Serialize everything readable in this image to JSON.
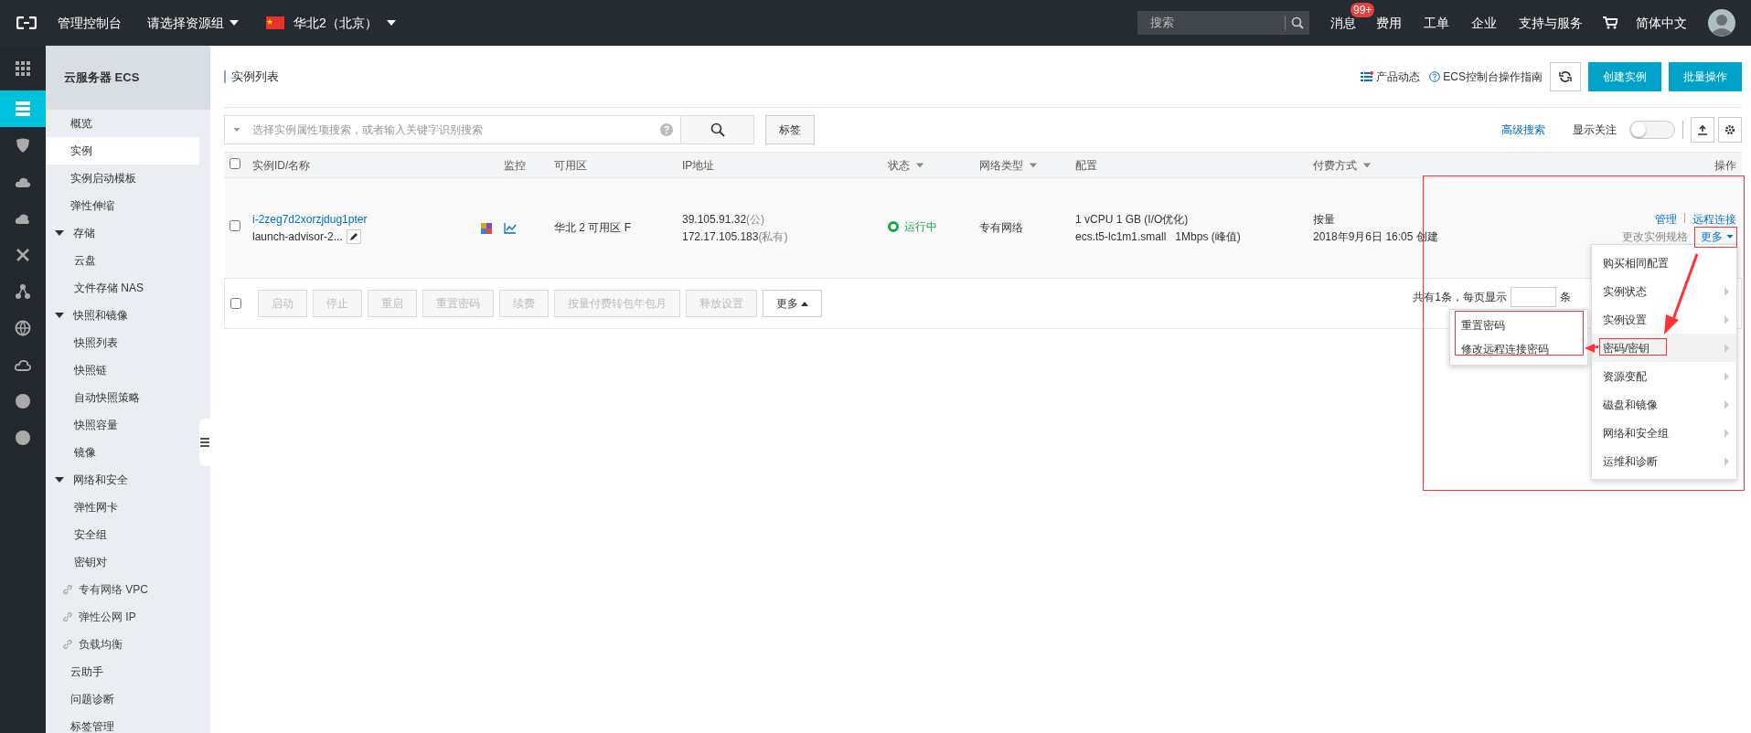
{
  "topbar": {
    "console": "管理控制台",
    "resource_group": "请选择资源组",
    "region": "华北2（北京）",
    "search": {
      "placeholder": "搜索"
    },
    "message": "消息",
    "message_badge": "99+",
    "links": [
      "费用",
      "工单",
      "企业",
      "支持与服务"
    ],
    "language": "简体中文"
  },
  "rail": [
    {
      "selected": false
    },
    {
      "selected": true
    },
    {
      "selected": false
    },
    {
      "selected": false
    },
    {
      "selected": false
    },
    {
      "selected": false
    },
    {
      "selected": false
    },
    {
      "selected": false
    },
    {
      "selected": false
    },
    {
      "selected": false
    },
    {
      "selected": false
    }
  ],
  "sidebar": {
    "title": "云服务器 ECS",
    "items": [
      {
        "kind": "item",
        "label": "概览",
        "selected": false
      },
      {
        "kind": "item",
        "label": "实例",
        "selected": true
      },
      {
        "kind": "item",
        "label": "实例启动模板",
        "selected": false
      },
      {
        "kind": "item",
        "label": "弹性伸缩",
        "selected": false
      },
      {
        "kind": "group",
        "label": "存储",
        "expanded": true,
        "children": [
          {
            "kind": "item",
            "label": "云盘",
            "selected": false
          },
          {
            "kind": "item",
            "label": "文件存储 NAS",
            "selected": false
          }
        ]
      },
      {
        "kind": "group",
        "label": "快照和镜像",
        "expanded": true,
        "children": [
          {
            "kind": "item",
            "label": "快照列表",
            "selected": false
          },
          {
            "kind": "item",
            "label": "快照链",
            "selected": false
          },
          {
            "kind": "item",
            "label": "自动快照策略",
            "selected": false
          },
          {
            "kind": "item",
            "label": "快照容量",
            "selected": false
          },
          {
            "kind": "item",
            "label": "镜像",
            "selected": false
          }
        ]
      },
      {
        "kind": "group",
        "label": "网络和安全",
        "expanded": true,
        "children": [
          {
            "kind": "item",
            "label": "弹性网卡",
            "selected": false
          },
          {
            "kind": "item",
            "label": "安全组",
            "selected": false
          },
          {
            "kind": "item",
            "label": "密钥对",
            "selected": false
          }
        ]
      },
      {
        "kind": "link",
        "label": "专有网络 VPC",
        "selected": false
      },
      {
        "kind": "link",
        "label": "弹性公网 IP",
        "selected": false
      },
      {
        "kind": "link",
        "label": "负载均衡",
        "selected": false
      },
      {
        "kind": "item",
        "label": "云助手",
        "selected": false
      },
      {
        "kind": "item",
        "label": "问题诊断",
        "selected": false
      },
      {
        "kind": "item",
        "label": "标签管理",
        "selected": false
      }
    ]
  },
  "page": {
    "title": "实例列表",
    "news": "产品动态",
    "guide": "ECS控制台操作指南",
    "create": "创建实例",
    "batch": "批量操作"
  },
  "search": {
    "placeholder": "选择实例属性项搜索，或者输入关键字识别搜索",
    "tag_button": "标签",
    "advanced": "高级搜索",
    "follow_label": "显示关注",
    "follow_on": false
  },
  "table": {
    "header_checked": false,
    "columns": [
      {
        "label": "实例ID/名称",
        "sortable": false
      },
      {
        "label": "监控",
        "sortable": false
      },
      {
        "label": "可用区",
        "sortable": false
      },
      {
        "label": "IP地址",
        "sortable": false
      },
      {
        "label": "状态",
        "sortable": true
      },
      {
        "label": "网络类型",
        "sortable": true
      },
      {
        "label": "配置",
        "sortable": false
      },
      {
        "label": "付费方式",
        "sortable": true
      },
      {
        "label": "操作",
        "sortable": false
      }
    ],
    "rows": [
      {
        "checked": false,
        "id": "i-2zeg7d2xorzjdug1pter",
        "name": "launch-advisor-2...",
        "zone": "华北 2 可用区 F",
        "public_ip": "39.105.91.32",
        "public_tag": "(公)",
        "private_ip": "172.17.105.183",
        "private_tag": "(私有)",
        "status": {
          "text": "运行中",
          "kind": "running"
        },
        "network": "专有网络",
        "config_1": "1 vCPU 1 GB (I/O优化)",
        "config_2": "ecs.t5-lc1m1.small   1Mbps (峰值)",
        "billing": "按量",
        "created": "2018年9月6日 16:05 创建",
        "actions": [
          "管理",
          "远程连接"
        ],
        "change_spec": "更改实例规格",
        "more": "更多"
      }
    ]
  },
  "footer": {
    "checked": false,
    "buttons": [
      {
        "label": "启动",
        "disabled": true
      },
      {
        "label": "停止",
        "disabled": true
      },
      {
        "label": "重启",
        "disabled": true
      },
      {
        "label": "重置密码",
        "disabled": true
      },
      {
        "label": "续费",
        "disabled": true
      },
      {
        "label": "按量付费转包年包月",
        "disabled": true
      },
      {
        "label": "释放设置",
        "disabled": true
      }
    ],
    "more": "更多",
    "pagination_text": "共有1条，每页显示",
    "pagination_unit": "条"
  },
  "more_menu": {
    "items": [
      {
        "label": "购买相同配置",
        "submenu": false,
        "selected": false
      },
      {
        "label": "实例状态",
        "submenu": true,
        "selected": false
      },
      {
        "label": "实例设置",
        "submenu": true,
        "selected": false
      },
      {
        "label": "密码/密钥",
        "submenu": true,
        "selected": true
      },
      {
        "label": "资源变配",
        "submenu": true,
        "selected": false
      },
      {
        "label": "磁盘和镜像",
        "submenu": true,
        "selected": false
      },
      {
        "label": "网络和安全组",
        "submenu": true,
        "selected": false
      },
      {
        "label": "运维和诊断",
        "submenu": true,
        "selected": false
      }
    ]
  },
  "submenu": {
    "items": [
      "重置密码",
      "修改远程连接密码"
    ]
  }
}
